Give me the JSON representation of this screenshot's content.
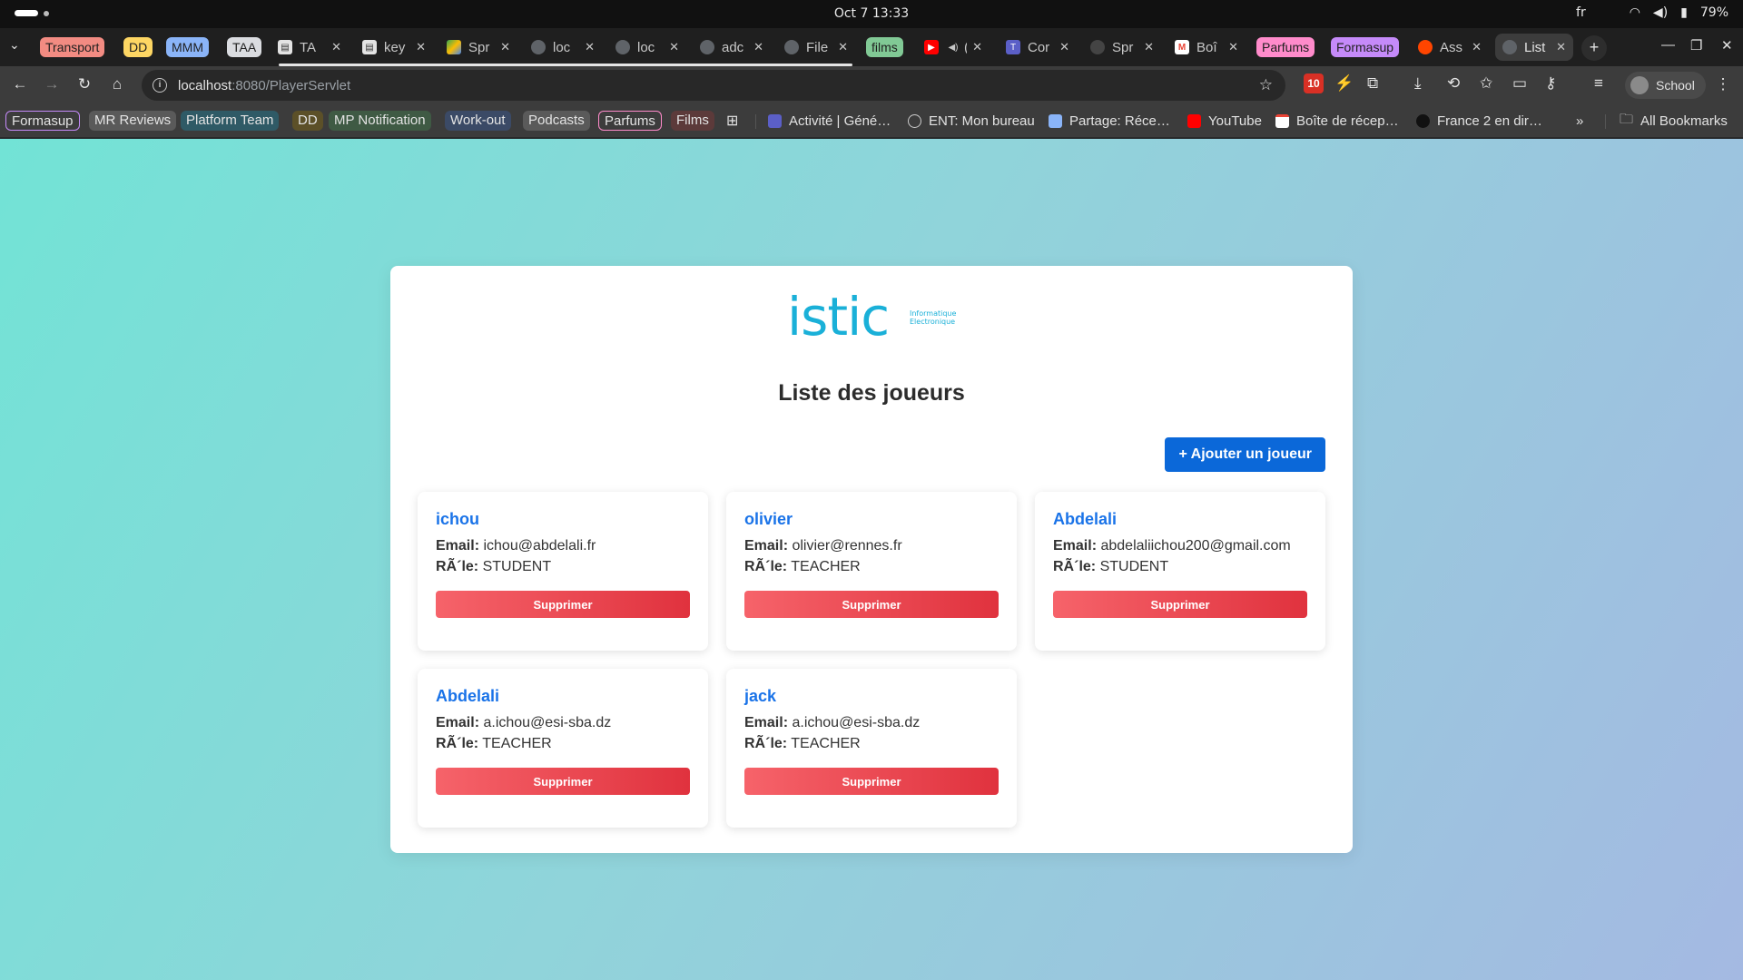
{
  "os": {
    "clock": "Oct 7  13:33",
    "lang": "fr",
    "battery": "79%"
  },
  "browser": {
    "tab_groups": [
      {
        "label": "Transport",
        "color": "#f28b82"
      },
      {
        "label": "DD",
        "color": "#fdd663"
      },
      {
        "label": "MMM",
        "color": "#8ab4f8"
      },
      {
        "label": "TAA",
        "color": "#dadce0"
      },
      {
        "label": "films",
        "color": "#81c995"
      },
      {
        "label": "Parfums",
        "color": "#ff8bcb"
      },
      {
        "label": "Formasup",
        "color": "#c58af9"
      }
    ],
    "tabs": [
      {
        "title": "TA",
        "icon": "doc-icon"
      },
      {
        "title": "key",
        "icon": "doc-icon"
      },
      {
        "title": "Spr",
        "icon": "drive-icon"
      },
      {
        "title": "loc",
        "icon": "globe-icon"
      },
      {
        "title": "loc",
        "icon": "globe-icon"
      },
      {
        "title": "adc",
        "icon": "github-icon"
      },
      {
        "title": "File",
        "icon": "github-icon"
      },
      {
        "title": "(",
        "icon": "youtube-icon"
      },
      {
        "title": "Cor",
        "icon": "teams-icon"
      },
      {
        "title": "Spr",
        "icon": "openai-icon"
      },
      {
        "title": "Boî",
        "icon": "gmail-icon"
      },
      {
        "title": "Ass",
        "icon": "reddit-icon"
      },
      {
        "title": "List",
        "icon": "globe-icon"
      }
    ],
    "url_host": "localhost",
    "url_rest": ":8080/PlayerServlet",
    "extension_badge": "10",
    "profile_name": "School",
    "bookmarks": {
      "groups": [
        {
          "label": "Formasup",
          "color": "#c58af9"
        },
        {
          "label": "MR Reviews",
          "color": "#dadce0"
        },
        {
          "label": "Platform Team",
          "color": "#78d9ec"
        },
        {
          "label": "DD",
          "color": "#fdd663"
        },
        {
          "label": "MP Notification",
          "color": "#a8dab5"
        },
        {
          "label": "Work-out",
          "color": "#8ab4f8"
        },
        {
          "label": "Podcasts",
          "color": "#dadce0"
        },
        {
          "label": "Parfums",
          "color": "#ff8bcb"
        },
        {
          "label": "Films",
          "color": "#f6aea9"
        }
      ],
      "links": [
        {
          "label": "Activité | Géné…",
          "icon": "teams-icon"
        },
        {
          "label": "ENT: Mon bureau",
          "icon": "globe-icon"
        },
        {
          "label": "Partage: Réce…",
          "icon": "page-icon"
        },
        {
          "label": "YouTube",
          "icon": "youtube-icon"
        },
        {
          "label": "Boîte de récep…",
          "icon": "gmail-icon"
        },
        {
          "label": "France 2 en dir…",
          "icon": "tv-icon"
        }
      ],
      "all_label": "All Bookmarks"
    }
  },
  "page": {
    "logo_text": "istic",
    "logo_sub_1": "Informatique",
    "logo_sub_2": "Electronique",
    "title": "Liste des joueurs",
    "add_button": "+ Ajouter un joueur",
    "email_label": "Email:",
    "role_label": "RÃ´le:",
    "delete_label": "Supprimer",
    "players": [
      {
        "name": "ichou",
        "email": "ichou@abdelali.fr",
        "role": "STUDENT"
      },
      {
        "name": "olivier",
        "email": "olivier@rennes.fr",
        "role": "TEACHER"
      },
      {
        "name": "Abdelali",
        "email": "abdelaliichou200@gmail.com",
        "role": "STUDENT"
      },
      {
        "name": "Abdelali",
        "email": "a.ichou@esi-sba.dz",
        "role": "TEACHER"
      },
      {
        "name": "jack",
        "email": "a.ichou@esi-sba.dz",
        "role": "TEACHER"
      }
    ]
  }
}
